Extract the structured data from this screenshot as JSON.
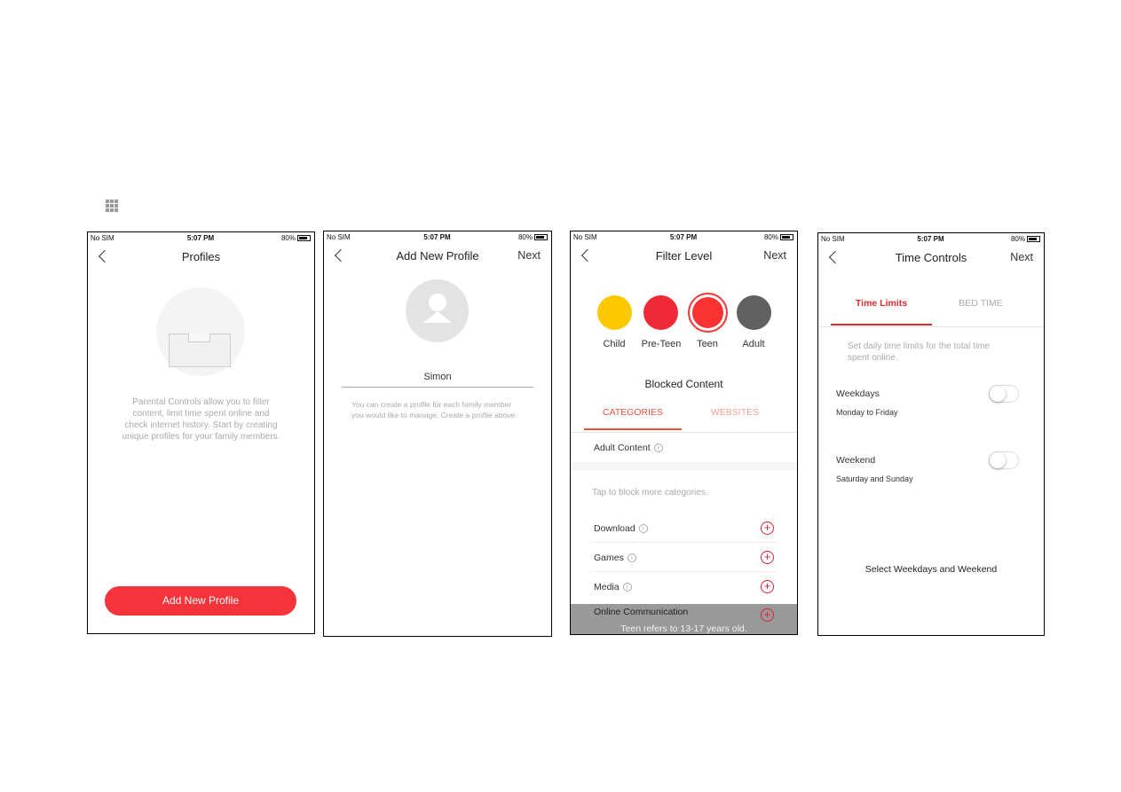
{
  "status": {
    "carrier": "No SIM",
    "time": "5:07 PM",
    "battery": "80%"
  },
  "screen1": {
    "title": "Profiles",
    "description": "Parental Controls allow you to filter content, limit time spent online and check internet history. Start by creating unique profiles for your family members.",
    "button": "Add New Profile"
  },
  "screen2": {
    "title": "Add New Profile",
    "next": "Next",
    "name_value": "Simon",
    "hint": "You can create a profile for each family member you would like to manage. Create a profile above."
  },
  "screen3": {
    "title": "Filter Level",
    "next": "Next",
    "levels": [
      {
        "label": "Child",
        "color": "#fdc800"
      },
      {
        "label": "Pre-Teen",
        "color": "#ee2a36"
      },
      {
        "label": "Teen",
        "color": "#fa3232"
      },
      {
        "label": "Adult",
        "color": "#606060"
      }
    ],
    "selected": "Teen",
    "section": "Blocked Content",
    "tabs": [
      "CATEGORIES",
      "WEBSITES"
    ],
    "blocked": "Adult Content",
    "hint": "Tap to block more categories.",
    "categories": [
      "Download",
      "Games",
      "Media",
      "Online Communication"
    ],
    "toast": "Teen refers to 13-17 years old."
  },
  "screen4": {
    "title": "Time Controls",
    "next": "Next",
    "tabs": [
      "Time Limits",
      "BED TIME"
    ],
    "description": "Set daily time limits for the total time spent online.",
    "rows": [
      {
        "label": "Weekdays",
        "sub": "Monday to Friday",
        "on": false
      },
      {
        "label": "Weekend",
        "sub": "Saturday and Sunday",
        "on": false
      }
    ],
    "footer": "Select Weekdays and Weekend"
  },
  "colors": {
    "accent": "#f5333a"
  }
}
